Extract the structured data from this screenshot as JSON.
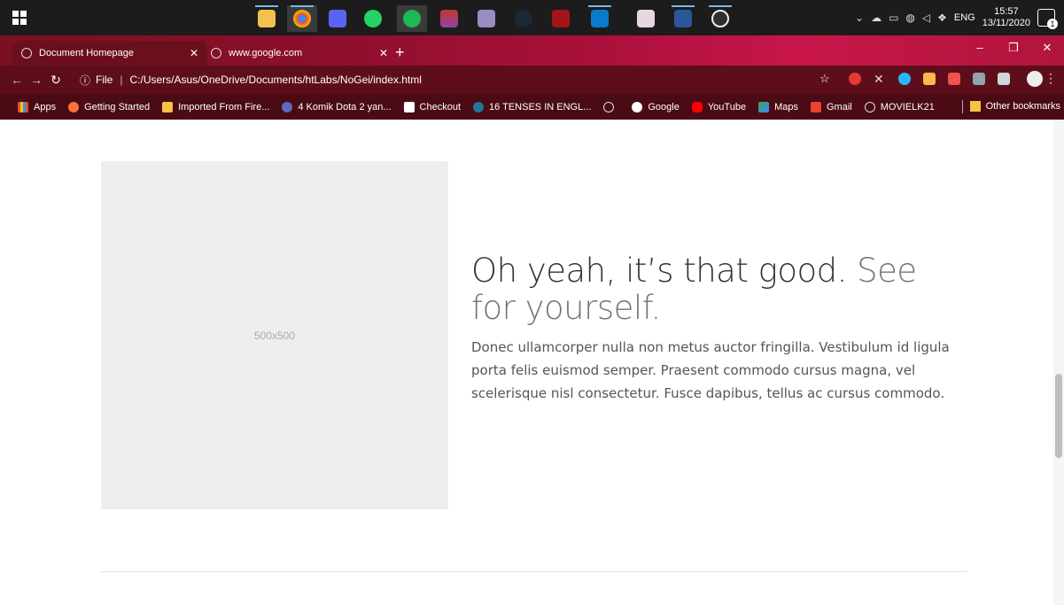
{
  "taskbar": {
    "tray": {
      "language": "ENG",
      "time": "15:57",
      "date": "13/11/2020",
      "notifications": "1"
    }
  },
  "browser": {
    "tabs": [
      {
        "label": "Document Homepage"
      },
      {
        "label": "www.google.com"
      }
    ],
    "address": {
      "prefix": "File",
      "url": "C:/Users/Asus/OneDrive/Documents/htLabs/NoGei/index.html"
    },
    "bookmarks": [
      "Apps",
      "Getting Started",
      "Imported From Fire...",
      "4 Komik Dota 2 yan...",
      "Checkout",
      "16 TENSES IN ENGL...",
      "",
      "Google",
      "YouTube",
      "Maps",
      "Gmail",
      "MOVIELK21"
    ],
    "other_bookmarks": "Other bookmarks"
  },
  "page": {
    "image_placeholder": "500x500",
    "heading": "Oh yeah, it’s that good.",
    "heading_muted": " See for yourself.",
    "lead": "Donec ullamcorper nulla non metus auctor fringilla. Vestibulum id ligula porta felis euismod semper. Praesent commodo cursus magna, vel scelerisque nisl consectetur. Fusce dapibus, tellus ac cursus commodo."
  }
}
